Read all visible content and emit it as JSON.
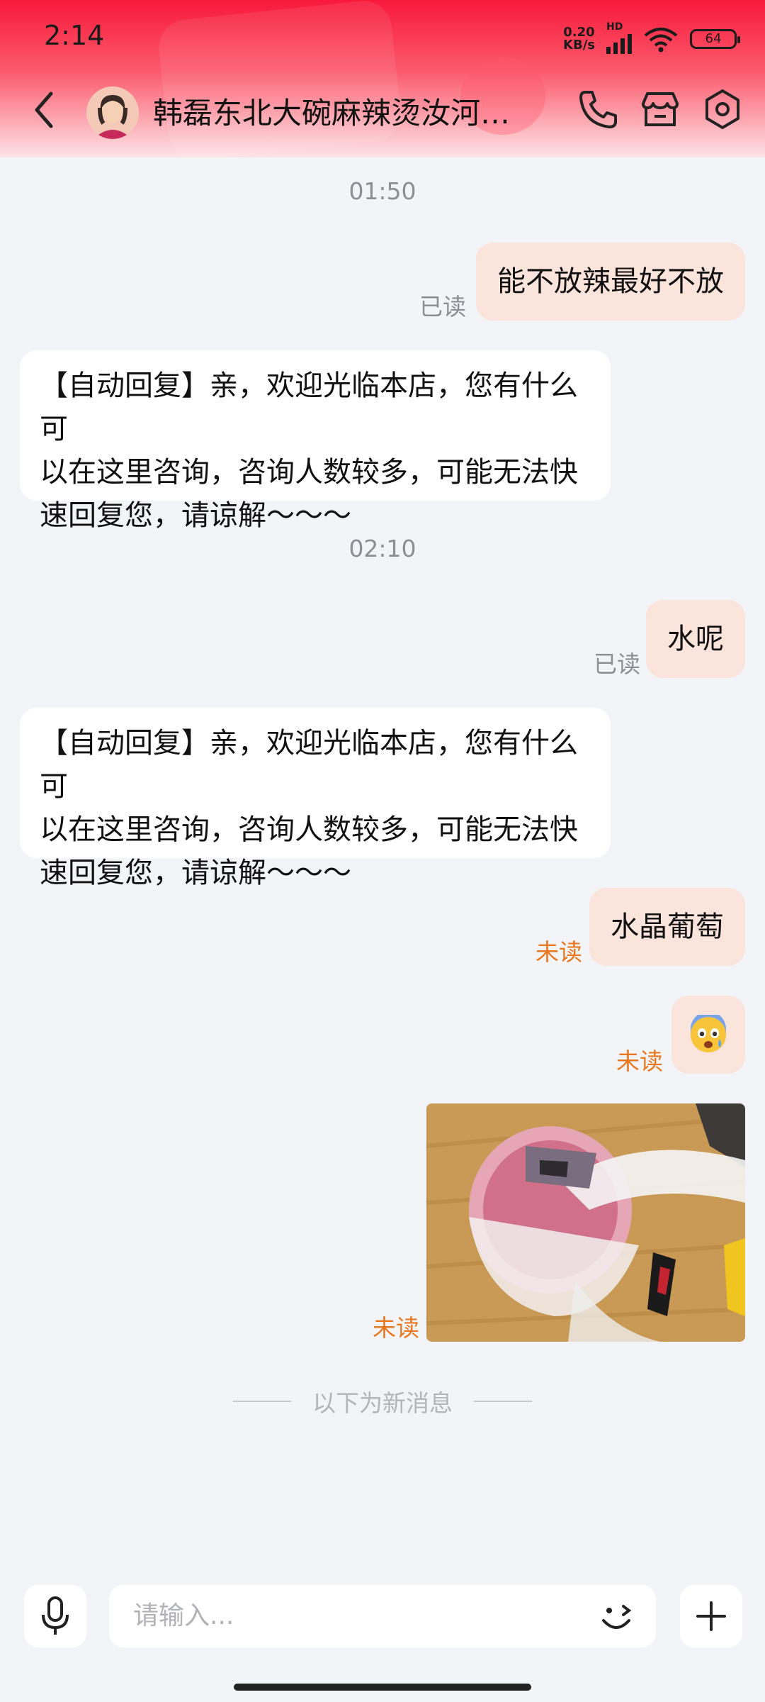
{
  "status_bar": {
    "time": "2:14",
    "net_speed_value": "0.20",
    "net_speed_unit": "KB/s",
    "network_type": "HD",
    "battery": "64"
  },
  "header": {
    "shop_name": "韩磊东北大碗麻辣烫汝河…",
    "back_icon": "chevron-left-icon",
    "phone_icon": "phone-icon",
    "store_icon": "store-icon",
    "settings_icon": "settings-icon"
  },
  "messages": [
    {
      "type": "time",
      "text": "01:50"
    },
    {
      "type": "sent",
      "text": "能不放辣最好不放",
      "receipt": "已读"
    },
    {
      "type": "received",
      "lines": [
        "【自动回复】亲，欢迎光临本店，您有什么可",
        "以在这里咨询，咨询人数较多，可能无法快",
        "速回复您，请谅解～～～"
      ]
    },
    {
      "type": "time",
      "text": "02:10"
    },
    {
      "type": "sent",
      "text": "水呢",
      "receipt": "已读"
    },
    {
      "type": "received",
      "lines": [
        "【自动回复】亲，欢迎光临本店，您有什么可",
        "以在这里咨询，咨询人数较多，可能无法快",
        "速回复您，请谅解～～～"
      ]
    },
    {
      "type": "sent",
      "text": "水晶葡萄",
      "receipt": "未读"
    },
    {
      "type": "sent_emoji",
      "emoji": "😨",
      "receipt": "未读"
    },
    {
      "type": "sent_image",
      "receipt": "未读"
    }
  ],
  "divider_text": "以下为新消息",
  "input": {
    "placeholder": "请输入..."
  },
  "colors": {
    "header_red": "#f8193a",
    "sent_bubble": "#fbe4dc",
    "received_bubble": "#ffffff",
    "unread": "#e8781f",
    "read": "#8d8f96",
    "background": "#f3f4f8"
  }
}
